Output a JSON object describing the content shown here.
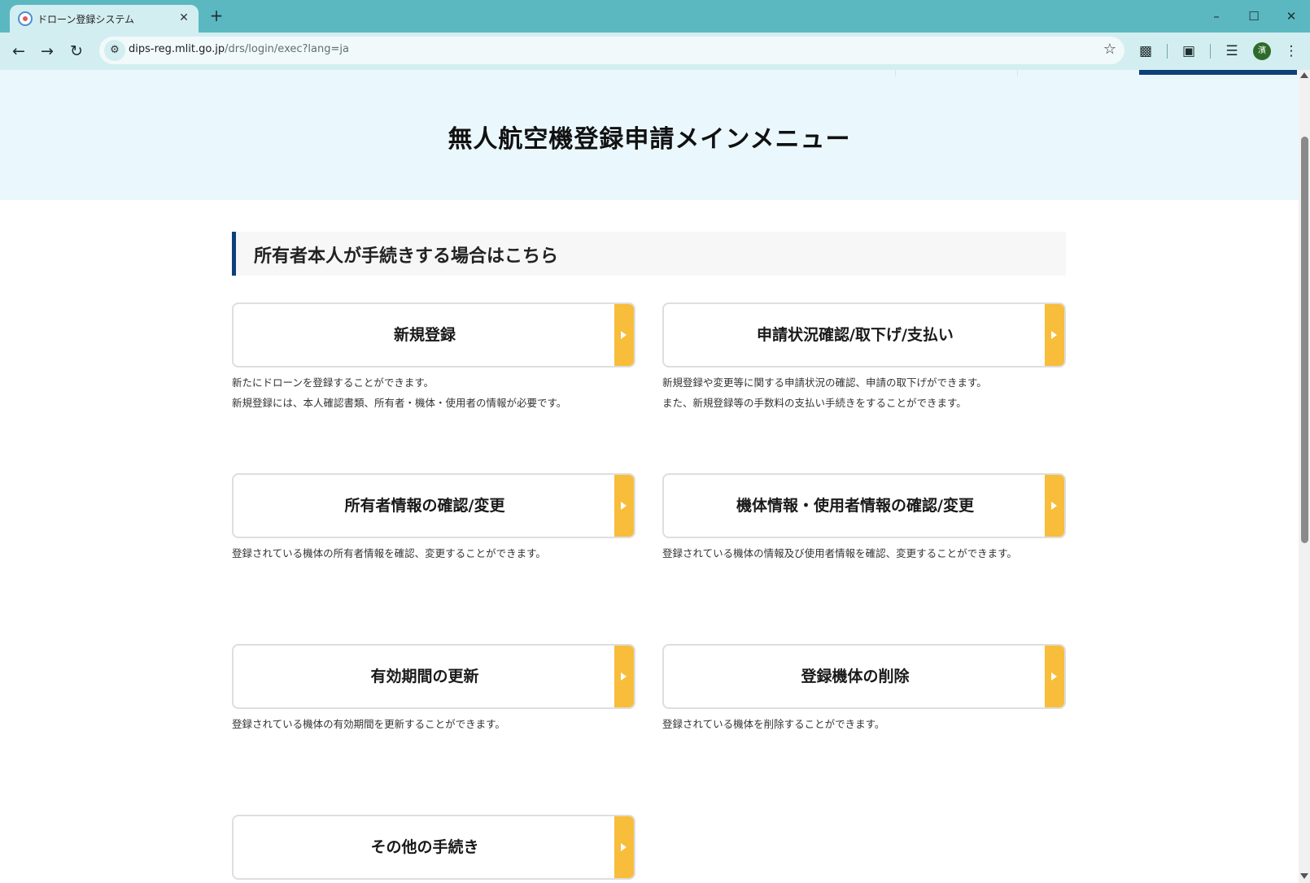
{
  "browser": {
    "tab_title": "ドローン登録システム",
    "tab_close": "✕",
    "new_tab": "+",
    "url_host": "dips-reg.mlit.go.jp",
    "url_path": "/drs/login/exec?lang=ja",
    "profile_initial": "濱"
  },
  "page": {
    "title": "無人航空機登録申請メインメニュー",
    "section_title": "所有者本人が手続きする場合はこちら"
  },
  "menu": [
    {
      "label": "新規登録",
      "desc": [
        "新たにドローンを登録することができます。",
        "新規登録には、本人確認書類、所有者・機体・使用者の情報が必要です。"
      ]
    },
    {
      "label": "申請状況確認/取下げ/支払い",
      "desc": [
        "新規登録や変更等に関する申請状況の確認、申請の取下げができます。",
        "また、新規登録等の手数料の支払い手続きをすることができます。"
      ]
    },
    {
      "label": "所有者情報の確認/変更",
      "desc": [
        "登録されている機体の所有者情報を確認、変更することができます。"
      ]
    },
    {
      "label": "機体情報・使用者情報の確認/変更",
      "desc": [
        "登録されている機体の情報及び使用者情報を確認、変更することができます。"
      ]
    },
    {
      "label": "有効期間の更新",
      "desc": [
        "登録されている機体の有効期間を更新することができます。"
      ]
    },
    {
      "label": "登録機体の削除",
      "desc": [
        "登録されている機体を削除することができます。"
      ]
    },
    {
      "label": "その他の手続き",
      "desc": []
    }
  ]
}
